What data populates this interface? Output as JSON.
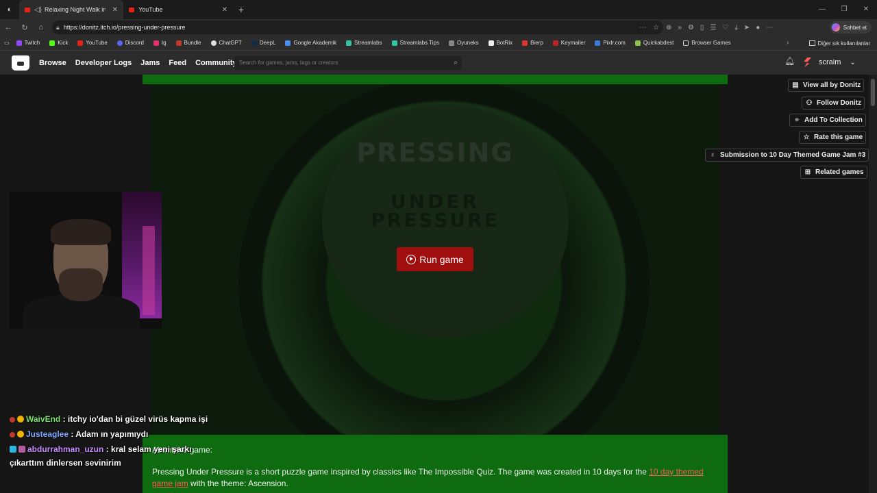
{
  "browser": {
    "tabs": [
      {
        "title": "Relaxing Night Walk in NEW Y",
        "active": true,
        "audio": true
      },
      {
        "title": "YouTube",
        "active": false,
        "audio": false
      }
    ],
    "url": "https://donitz.itch.io/pressing-under-pressure",
    "copilot_label": "Sohbet et",
    "bookmarks": [
      "Twitch",
      "Kick",
      "YouTube",
      "Discord",
      "Ig",
      "Bundle",
      "ChatGPT",
      "DeepL",
      "Google Akademik",
      "Streamlabs",
      "Streamlabs Tips",
      "Oyuneks",
      "BotRix",
      "Bierp",
      "Keymailer",
      "Pixlr.com",
      "Quickabdest",
      "Browser Games"
    ],
    "other_favorites": "Diğer sık kullanılanlar"
  },
  "itch": {
    "nav": [
      "Browse",
      "Developer Logs",
      "Jams",
      "Feed",
      "Community"
    ],
    "search_placeholder": "Search for games, jams, tags or creators",
    "username": "scraim"
  },
  "game": {
    "logo_line1": "PRESSING",
    "logo_line2": "UNDER",
    "logo_line3": "PRESSURE",
    "run_label": "Run game",
    "about_heading": "About the game:",
    "description_before": "Pressing Under Pressure is a short puzzle game inspired by classics like The Impossible Quiz. The game was created in 10 days for the ",
    "description_link": "10 day themed game jam",
    "description_after": " with the theme: Ascension."
  },
  "actions": [
    {
      "label": "View all by Donitz",
      "icon": "store-icon"
    },
    {
      "label": "Follow Donitz",
      "icon": "follow-icon"
    },
    {
      "label": "Add To Collection",
      "icon": "collection-icon"
    },
    {
      "label": "Rate this game",
      "icon": "star-icon"
    },
    {
      "label": "Submission to 10 Day Themed Game Jam #3",
      "icon": "award-icon"
    },
    {
      "label": "Related games",
      "icon": "map-icon"
    }
  ],
  "chat": [
    {
      "user": "WaivEnd",
      "text": ": itchy io'dan bi güzel virüs kapma işi"
    },
    {
      "user": "Justeaglee",
      "text": ": Adam ın yapımıydı"
    },
    {
      "user": "abdurrahman_uzun",
      "text": ": kral selam yeni şarkı çıkarttım dinlersen sevinirim"
    }
  ]
}
